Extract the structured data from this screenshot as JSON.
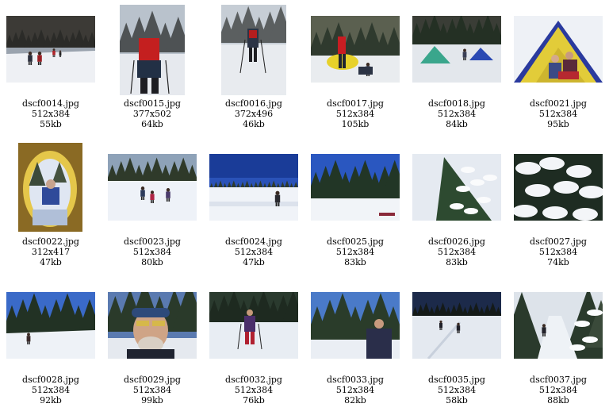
{
  "gallery": {
    "items": [
      {
        "filename": "dscf0014.jpg",
        "dimensions": "512x384",
        "size": "55kb",
        "scene": "snow-trail-group",
        "orientation": "landscape"
      },
      {
        "filename": "dscf0015.jpg",
        "dimensions": "377x502",
        "size": "64kb",
        "scene": "hiker-red-pack-back",
        "orientation": "portrait"
      },
      {
        "filename": "dscf0016.jpg",
        "dimensions": "372x496",
        "size": "46kb",
        "scene": "hiker-poles-forest",
        "orientation": "portrait"
      },
      {
        "filename": "dscf0017.jpg",
        "dimensions": "512x384",
        "size": "105kb",
        "scene": "camp-yellow-tent",
        "orientation": "landscape"
      },
      {
        "filename": "dscf0018.jpg",
        "dimensions": "512x384",
        "size": "84kb",
        "scene": "two-tents-snow",
        "orientation": "landscape"
      },
      {
        "filename": "dscf0021.jpg",
        "dimensions": "512x384",
        "size": "95kb",
        "scene": "people-inside-tent",
        "orientation": "landscape"
      },
      {
        "filename": "dscf0022.jpg",
        "dimensions": "312x417",
        "size": "47kb",
        "scene": "view-from-tent",
        "orientation": "portrait"
      },
      {
        "filename": "dscf0023.jpg",
        "dimensions": "512x384",
        "size": "80kb",
        "scene": "three-snowshoers",
        "orientation": "landscape"
      },
      {
        "filename": "dscf0024.jpg",
        "dimensions": "512x384",
        "size": "47kb",
        "scene": "open-field-hiker",
        "orientation": "landscape"
      },
      {
        "filename": "dscf0025.jpg",
        "dimensions": "512x384",
        "size": "83kb",
        "scene": "spruce-clearing",
        "orientation": "landscape"
      },
      {
        "filename": "dscf0026.jpg",
        "dimensions": "512x384",
        "size": "83kb",
        "scene": "snowy-spruce-closeup",
        "orientation": "landscape"
      },
      {
        "filename": "dscf0027.jpg",
        "dimensions": "512x384",
        "size": "74kb",
        "scene": "snow-laden-branches",
        "orientation": "landscape"
      },
      {
        "filename": "dscf0028.jpg",
        "dimensions": "512x384",
        "size": "92kb",
        "scene": "forest-trail-blue-sky",
        "orientation": "landscape"
      },
      {
        "filename": "dscf0029.jpg",
        "dimensions": "512x384",
        "size": "99kb",
        "scene": "man-sunglasses-portrait",
        "orientation": "landscape"
      },
      {
        "filename": "dscf0032.jpg",
        "dimensions": "512x384",
        "size": "76kb",
        "scene": "snowshoer-purple-jacket",
        "orientation": "landscape"
      },
      {
        "filename": "dscf0033.jpg",
        "dimensions": "512x384",
        "size": "82kb",
        "scene": "man-standing-trees",
        "orientation": "landscape"
      },
      {
        "filename": "dscf0035.jpg",
        "dimensions": "512x384",
        "size": "58kb",
        "scene": "open-snow-two-hikers",
        "orientation": "landscape"
      },
      {
        "filename": "dscf0037.jpg",
        "dimensions": "512x384",
        "size": "88kb",
        "scene": "hiker-in-forest-trail",
        "orientation": "landscape"
      }
    ]
  }
}
